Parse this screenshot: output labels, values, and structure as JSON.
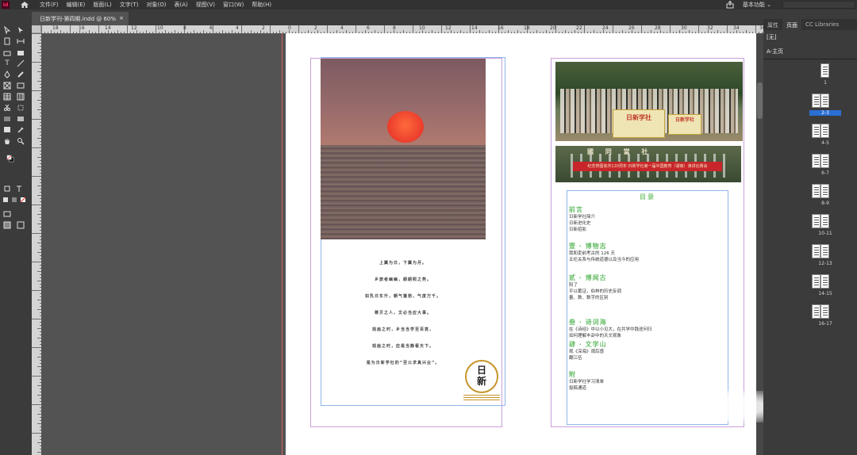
{
  "app": {
    "logo": "Id",
    "menus": [
      "文件(F)",
      "编辑(E)",
      "版面(L)",
      "文字(T)",
      "对象(O)",
      "表(A)",
      "视图(V)",
      "窗口(W)",
      "帮助(H)"
    ],
    "workspace": "基本功能 ⌄"
  },
  "document": {
    "tab_title": "日新学刊-第四期.indd @ 60%",
    "close_glyph": "×"
  },
  "ruler": {
    "top_labels": [
      "18",
      "16",
      "14",
      "12",
      "10",
      "8",
      "6",
      "4",
      "2",
      "0",
      "2",
      "4",
      "6",
      "8",
      "10",
      "12",
      "14",
      "16",
      "18",
      "20",
      "22",
      "24",
      "26",
      "28",
      "30",
      "32",
      "34",
      "36"
    ]
  },
  "left_page": {
    "poem": [
      "上翼为日，下翼为月。",
      "乡旅者幽幽，朗朗照之势。",
      "如乳日东升，朝气蓬勃，气度万千。",
      "尊贝之人，文必当应大事。",
      "观画之时，乡当当学至百竟，",
      "观画之时，应是当静看天下。",
      "是为日新学社的“至公求真兴业”。"
    ],
    "seal_text": "日\n新"
  },
  "right_page": {
    "photo1_banner": "日新学社",
    "photo1_banner2": "日新学社",
    "photo2_sign": "國   同   當   社",
    "photo2_banner": "纪念贺图家庆120周年·日新学社第一届中国教育（湖南）演讲比赛会",
    "toc_title": "目录",
    "sections": [
      {
        "heading": "前言",
        "items": [
          "日新学社简介",
          "日新进化史",
          "日新招影"
        ]
      },
      {
        "heading": "壹 · 博物志",
        "items": [
          "我和吏前考古的 126 天",
          "五伦关系与传统道德以及当今的应用"
        ]
      },
      {
        "heading": "贰 · 博闻古",
        "items": [
          "阳了",
          "平以蓄证，伯林的历史反调",
          "量、数、数字的区别"
        ]
      },
      {
        "heading": "叁 · 诗词海",
        "items": [
          "在《诗经》中以小见大，在共学中践途问归",
          "如何理解丰卦中的天文观象"
        ]
      },
      {
        "heading": "肆 · 文学山",
        "items": [
          "观《深海》观后感",
          "翻江伍"
        ]
      },
      {
        "heading": "附",
        "items": [
          "日新学社学习清单",
          "投稿通道"
        ]
      }
    ]
  },
  "panel": {
    "tabs": [
      "属性",
      "页面",
      "CC Libraries"
    ],
    "active_tab": "页面",
    "none_label": "[无]",
    "master_label": "A-主页",
    "thumbnails": [
      {
        "label": "1",
        "selected": false
      },
      {
        "label": "2-3",
        "selected": true
      },
      {
        "label": "4-5",
        "selected": false
      },
      {
        "label": "6-7",
        "selected": false
      },
      {
        "label": "8-9",
        "selected": false
      },
      {
        "label": "10-11",
        "selected": false
      },
      {
        "label": "12-13",
        "selected": false
      },
      {
        "label": "14-15",
        "selected": false
      },
      {
        "label": "16-17",
        "selected": false
      }
    ]
  },
  "colors": {
    "accent": "#2a6fd4",
    "toc_green": "#6bbf6b",
    "seal_gold": "#c6952a",
    "banner_red": "#c8262a"
  },
  "toolbar": {
    "type_tool_glyph": "T"
  }
}
